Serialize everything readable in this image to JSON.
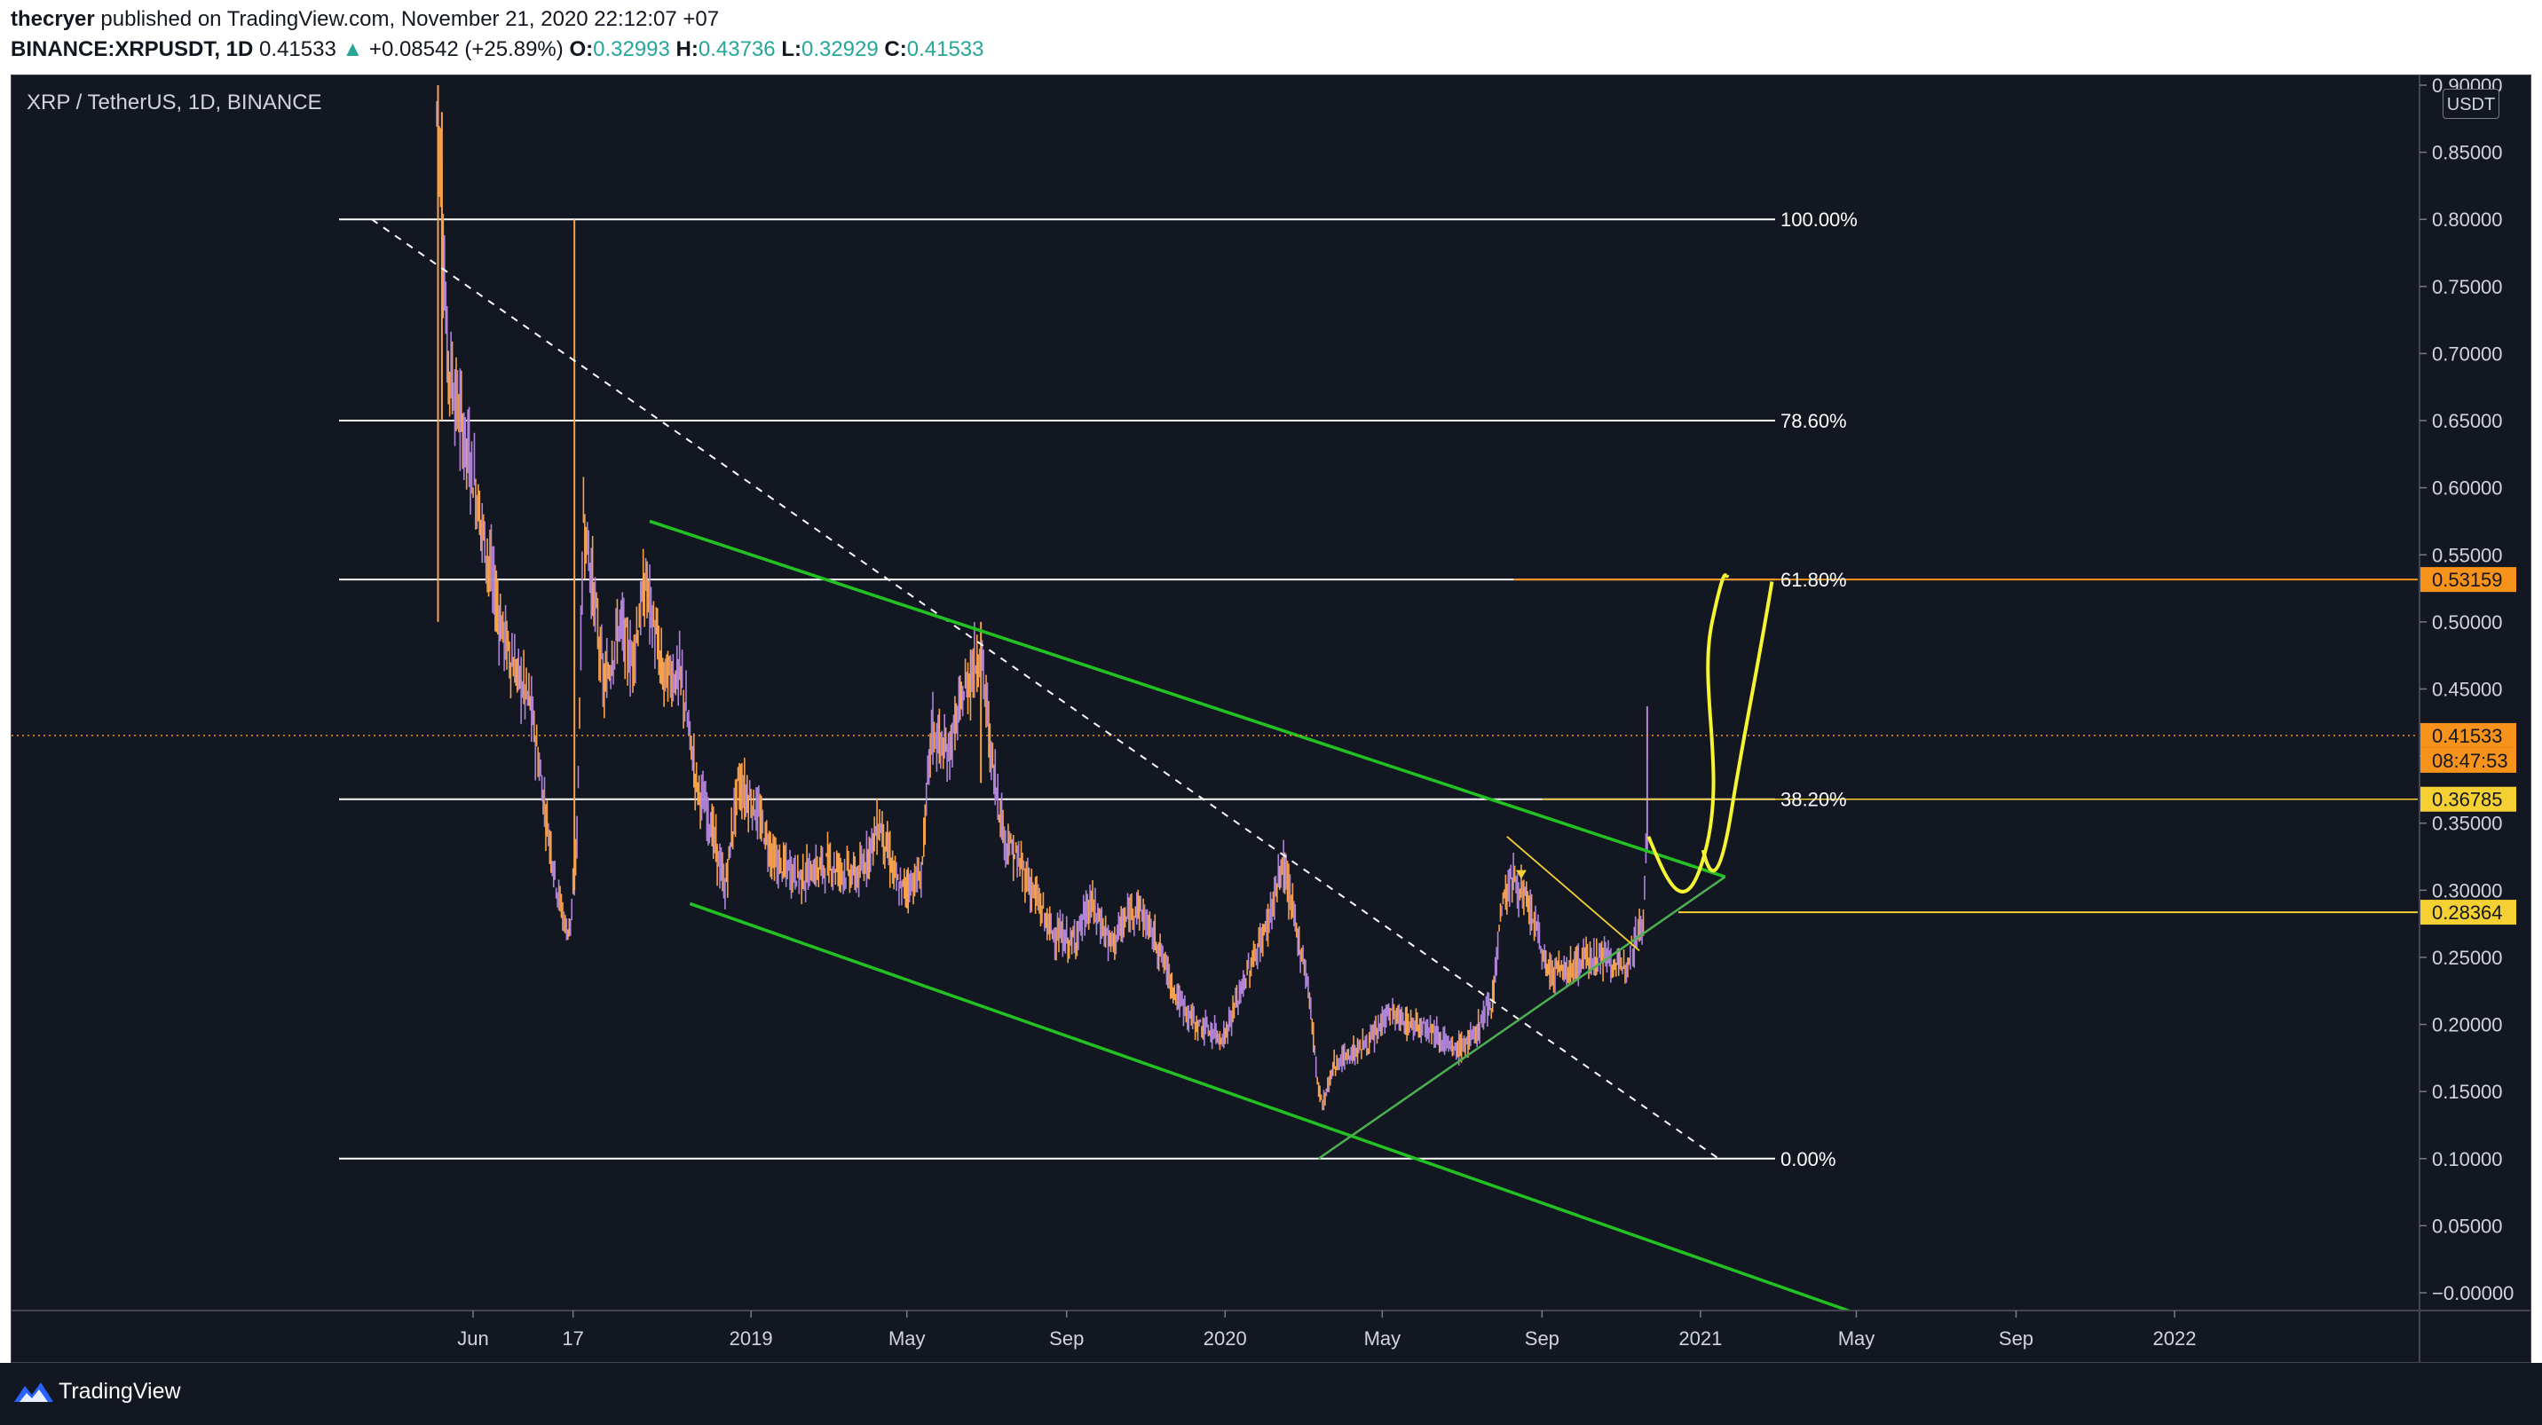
{
  "header": {
    "publisher": "thecryer",
    "published_text": "published on TradingView.com, November 21, 2020 22:12:07 +07",
    "symbol": "BINANCE:XRPUSDT, 1D",
    "last": "0.41533",
    "arrow": "▲",
    "change": "+0.08542 (+25.89%)",
    "o_label": "O:",
    "o_value": "0.32993",
    "h_label": "H:",
    "h_value": "0.43736",
    "l_label": "L:",
    "l_value": "0.32929",
    "c_label": "C:",
    "c_value": "0.41533"
  },
  "chart": {
    "symbol_title": "XRP / TetherUS, 1D, BINANCE",
    "currency_button": "USDT",
    "colors": {
      "background": "#131722",
      "candle": "#f7a24b",
      "candle_alt": "#b084d9",
      "channel": "#23c223",
      "fib": "#ffffff",
      "projection": "#f5f533",
      "price_line": "#f7931a"
    }
  },
  "footer": {
    "brand": "TradingView",
    "logo_icon": "tradingview-logo-icon"
  },
  "chart_data": {
    "type": "candlestick",
    "title": "XRP / TetherUS, 1D, BINANCE",
    "y_axis": {
      "ticks": [
        "0.90000",
        "0.85000",
        "0.80000",
        "0.75000",
        "0.70000",
        "0.65000",
        "0.60000",
        "0.55000",
        "0.50000",
        "0.45000",
        "0.40000",
        "0.35000",
        "0.30000",
        "0.25000",
        "0.20000",
        "0.15000",
        "0.10000",
        "0.05000",
        "−0.00000"
      ],
      "range": [
        -0.005,
        0.905
      ],
      "position": "right"
    },
    "x_axis": {
      "ticks": [
        {
          "label": "Jun",
          "date": "2018-06-01"
        },
        {
          "label": "17",
          "date": "2018-08-17"
        },
        {
          "label": "2019",
          "date": "2019-01-01"
        },
        {
          "label": "May",
          "date": "2019-05-01"
        },
        {
          "label": "Sep",
          "date": "2019-09-01"
        },
        {
          "label": "2020",
          "date": "2020-01-01"
        },
        {
          "label": "May",
          "date": "2020-05-01"
        },
        {
          "label": "Sep",
          "date": "2020-09-01"
        },
        {
          "label": "2021",
          "date": "2021-01-01"
        },
        {
          "label": "May",
          "date": "2021-05-01"
        },
        {
          "label": "Sep",
          "date": "2021-09-01"
        },
        {
          "label": "2022",
          "date": "2022-01-01"
        }
      ],
      "range": [
        "2018-01-01",
        "2022-09-01"
      ]
    },
    "price_path": [
      [
        "2018-05-04",
        0.88
      ],
      [
        "2018-05-07",
        0.84
      ],
      [
        "2018-05-12",
        0.7
      ],
      [
        "2018-05-20",
        0.66
      ],
      [
        "2018-06-01",
        0.61
      ],
      [
        "2018-06-10",
        0.56
      ],
      [
        "2018-06-22",
        0.5
      ],
      [
        "2018-07-01",
        0.47
      ],
      [
        "2018-07-15",
        0.44
      ],
      [
        "2018-07-28",
        0.35
      ],
      [
        "2018-08-05",
        0.3
      ],
      [
        "2018-08-12",
        0.27
      ],
      [
        "2018-08-16",
        0.28
      ],
      [
        "2018-08-20",
        0.34
      ],
      [
        "2018-08-25",
        0.58
      ],
      [
        "2018-09-02",
        0.52
      ],
      [
        "2018-09-10",
        0.45
      ],
      [
        "2018-09-22",
        0.5
      ],
      [
        "2018-10-01",
        0.47
      ],
      [
        "2018-10-12",
        0.53
      ],
      [
        "2018-10-25",
        0.46
      ],
      [
        "2018-11-08",
        0.46
      ],
      [
        "2018-11-20",
        0.38
      ],
      [
        "2018-12-01",
        0.35
      ],
      [
        "2018-12-12",
        0.3
      ],
      [
        "2018-12-22",
        0.38
      ],
      [
        "2019-01-05",
        0.36
      ],
      [
        "2019-01-20",
        0.32
      ],
      [
        "2019-02-10",
        0.31
      ],
      [
        "2019-03-01",
        0.32
      ],
      [
        "2019-03-25",
        0.31
      ],
      [
        "2019-04-10",
        0.35
      ],
      [
        "2019-04-25",
        0.3
      ],
      [
        "2019-05-12",
        0.31
      ],
      [
        "2019-05-20",
        0.42
      ],
      [
        "2019-06-01",
        0.4
      ],
      [
        "2019-06-15",
        0.45
      ],
      [
        "2019-06-27",
        0.48
      ],
      [
        "2019-07-05",
        0.4
      ],
      [
        "2019-07-15",
        0.34
      ],
      [
        "2019-08-01",
        0.31
      ],
      [
        "2019-08-20",
        0.27
      ],
      [
        "2019-09-05",
        0.26
      ],
      [
        "2019-09-20",
        0.29
      ],
      [
        "2019-10-05",
        0.26
      ],
      [
        "2019-10-25",
        0.29
      ],
      [
        "2019-11-10",
        0.26
      ],
      [
        "2019-11-25",
        0.22
      ],
      [
        "2019-12-10",
        0.2
      ],
      [
        "2019-12-31",
        0.19
      ],
      [
        "2020-01-15",
        0.23
      ],
      [
        "2020-02-01",
        0.27
      ],
      [
        "2020-02-15",
        0.32
      ],
      [
        "2020-02-25",
        0.27
      ],
      [
        "2020-03-05",
        0.23
      ],
      [
        "2020-03-12",
        0.16
      ],
      [
        "2020-03-16",
        0.14
      ],
      [
        "2020-03-25",
        0.17
      ],
      [
        "2020-04-10",
        0.18
      ],
      [
        "2020-04-25",
        0.19
      ],
      [
        "2020-05-05",
        0.21
      ],
      [
        "2020-05-20",
        0.2
      ],
      [
        "2020-06-05",
        0.2
      ],
      [
        "2020-06-25",
        0.18
      ],
      [
        "2020-07-10",
        0.19
      ],
      [
        "2020-07-25",
        0.22
      ],
      [
        "2020-08-01",
        0.29
      ],
      [
        "2020-08-10",
        0.31
      ],
      [
        "2020-08-25",
        0.28
      ],
      [
        "2020-09-05",
        0.24
      ],
      [
        "2020-09-20",
        0.24
      ],
      [
        "2020-10-05",
        0.25
      ],
      [
        "2020-10-20",
        0.25
      ],
      [
        "2020-11-01",
        0.24
      ],
      [
        "2020-11-10",
        0.26
      ],
      [
        "2020-11-18",
        0.28
      ],
      [
        "2020-11-20",
        0.33
      ],
      [
        "2020-11-21",
        0.41533
      ]
    ],
    "fib_levels": [
      {
        "label": "100.00%",
        "price": 0.8
      },
      {
        "label": "78.60%",
        "price": 0.65
      },
      {
        "label": "61.80%",
        "price": 0.53159
      },
      {
        "label": "38.20%",
        "price": 0.36785
      },
      {
        "label": "0.00%",
        "price": 0.1
      }
    ],
    "trend_lines": [
      {
        "name": "descending-dashed",
        "from": [
          "2018-03-15",
          0.8
        ],
        "to": [
          "2021-01-15",
          0.1
        ]
      },
      {
        "name": "channel-upper",
        "from": [
          "2018-10-15",
          0.575
        ],
        "to": [
          "2021-01-20",
          0.31
        ]
      },
      {
        "name": "channel-lower",
        "from": [
          "2018-11-15",
          0.29
        ],
        "to": [
          "2021-04-30",
          -0.015
        ]
      },
      {
        "name": "rising-support",
        "from": [
          "2020-03-13",
          0.1
        ],
        "to": [
          "2021-01-20",
          0.31
        ]
      }
    ],
    "price_labels": [
      {
        "text": "0.53159",
        "price": 0.53159,
        "color": "#f7931a"
      },
      {
        "text": "0.41533",
        "price": 0.41533,
        "color": "#f7931a",
        "sub": "08:47:53"
      },
      {
        "text": "0.36785",
        "price": 0.36785,
        "color": "#f5d033"
      },
      {
        "text": "0.28364",
        "price": 0.28364,
        "color": "#f5d033"
      }
    ],
    "current_price": 0.41533
  }
}
